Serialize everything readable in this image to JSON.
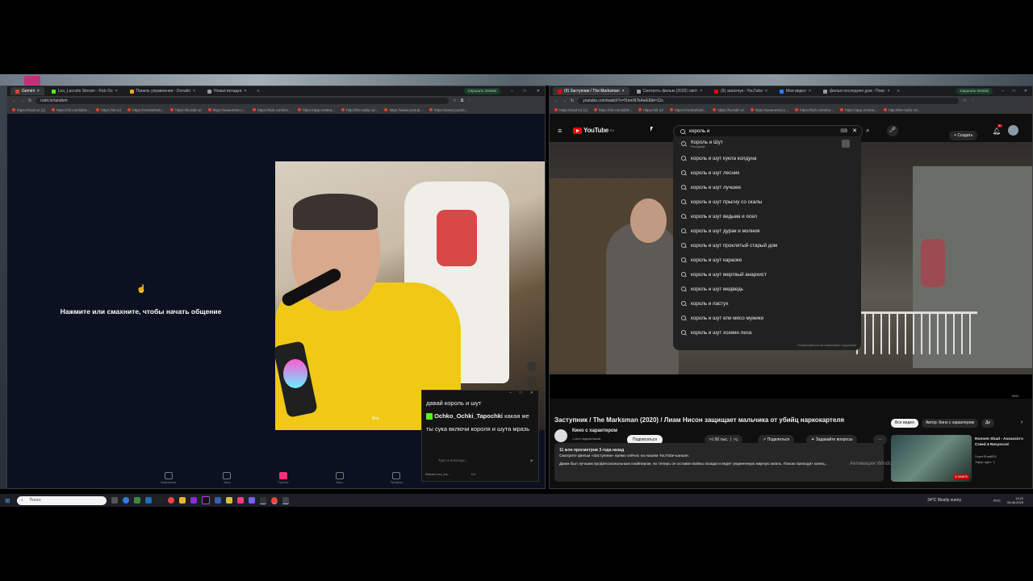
{
  "left_browser": {
    "tabs": [
      {
        "label": "Gemini",
        "color": "#e0432c",
        "active": true
      },
      {
        "label": "Leo_Lacoste Stream - Kick Ov",
        "color": "#53fc18",
        "active": false
      },
      {
        "label": "Панель управления - Donatio",
        "color": "#f5a623",
        "active": false
      },
      {
        "label": "Новая вкладка",
        "color": "#999999",
        "active": false
      }
    ],
    "gemini_button": "Спросить Gemini",
    "url": "rulet.tv/random",
    "bookmarks": [
      "https://mail.ru/ (1)",
      "https://vk.com/id19...",
      "https://ok.ru/",
      "https://vorlotefank...",
      "https://korabl.ru/",
      "https://www.temu.c...",
      "https://kick.com/leo...",
      "https://app.restrea...",
      "http://the-radio.ru/...",
      "https://www.youtub...",
      "https://www.youtub..."
    ]
  },
  "rulet": {
    "prompt": "Нажмите или смахните, чтобы начать общение",
    "cam_overlay": "Все",
    "nav": [
      "Знакомства",
      "Чаты",
      "Рулетка",
      "Игры",
      "Профиль"
    ]
  },
  "chat": {
    "line1": "давай король и шут",
    "user": "Ochko_Ochki_Tapochki",
    "line2": "какая же ты сука включи короля и шута мразь",
    "input_placeholder": "Type a message...",
    "footer": "Stream Leo_La...",
    "counter": "1/1"
  },
  "right_browser": {
    "tabs": [
      {
        "label": "(9) Заступник / The Marksman",
        "color": "#ff0000",
        "active": true
      },
      {
        "label": "Смотреть фильм (2020) смот",
        "color": "#999999",
        "active": false
      },
      {
        "label": "(9) запахчук - YouTube",
        "color": "#ff0000",
        "active": false
      },
      {
        "label": "Мои видео",
        "color": "#2d7ff9",
        "active": false
      },
      {
        "label": "фильм последнее дом - Поис",
        "color": "#999999",
        "active": false
      }
    ],
    "gemini_button": "Спросить Gemini",
    "url": "youtube.com/watch?v=f1nmN7kAwE8&t=11s",
    "bookmarks": [
      "https://mail.ru/ (1)",
      "https://vk.com/id19...",
      "https://ok.ru/",
      "https://vorlotefank...",
      "https://korabl.ru/",
      "https://www.temu.c...",
      "https://kick.com/leo...",
      "https://app.restrea...",
      "http://the-radio.ru/..."
    ]
  },
  "youtube": {
    "logo_text": "YouTube",
    "logo_badge": "RU",
    "search_value": "король и",
    "create": "Создать",
    "notif_count": "9+",
    "suggestions": [
      {
        "text": "Король и Шут",
        "sub": "Рок-группа"
      },
      {
        "text": "король и шут кукла колдуна"
      },
      {
        "text": "король и шут лесник"
      },
      {
        "text": "король и шут лучшее"
      },
      {
        "text": "король и шут прыгну со скалы"
      },
      {
        "text": "король и шут ведьма и осел"
      },
      {
        "text": "король и шут дурак и молния"
      },
      {
        "text": "король и шут проклятый старый дом"
      },
      {
        "text": "король и шут караоке"
      },
      {
        "text": "король и шут мертвый анархист"
      },
      {
        "text": "король и шут медведь"
      },
      {
        "text": "король и пастух"
      },
      {
        "text": "король и шут ели мясо мужики"
      },
      {
        "text": "король и шут хозяин леса"
      }
    ],
    "suggestions_footer": "Пожаловаться на поисковые подсказки",
    "video_title": "Заступник / The Marksman (2020) / Лиам Нисон защищает мальчика от убийц наркокартеля",
    "channel": "Кино с характером",
    "subs": "1 млн подписчиков",
    "subscribe": "Подписаться",
    "likes": "50 тыс.",
    "share": "Поделиться",
    "ask": "Задавайте вопросы",
    "views": "11 млн просмотров  3 года назад",
    "desc1": "Смотрите фильм «Заступник» прямо сейчас на нашем YouTube-канале.",
    "desc2": "Джим был лучшим профессиональным снайпером, но теперь он оставил войны позади и ведет уединенную мирную жизнь. Покою приходит конец...",
    "chips": [
      "Все видео",
      "Автор: Кино с характером",
      "Де"
    ],
    "rec_title": "Ronnen Shad - Assassin's Creed 4 Rexyncod",
    "rec_channel": "SuperShad833",
    "rec_views": "Эфир идёт: 1",
    "live_badge": "В ЭФИРЕ",
    "watermark": "Активация Windows"
  },
  "taskbar": {
    "search_placeholder": "Поиск",
    "weather": "34°C  Mostly sunny",
    "lang": "РУС",
    "time": "13:22",
    "date": "06.08.2025"
  }
}
